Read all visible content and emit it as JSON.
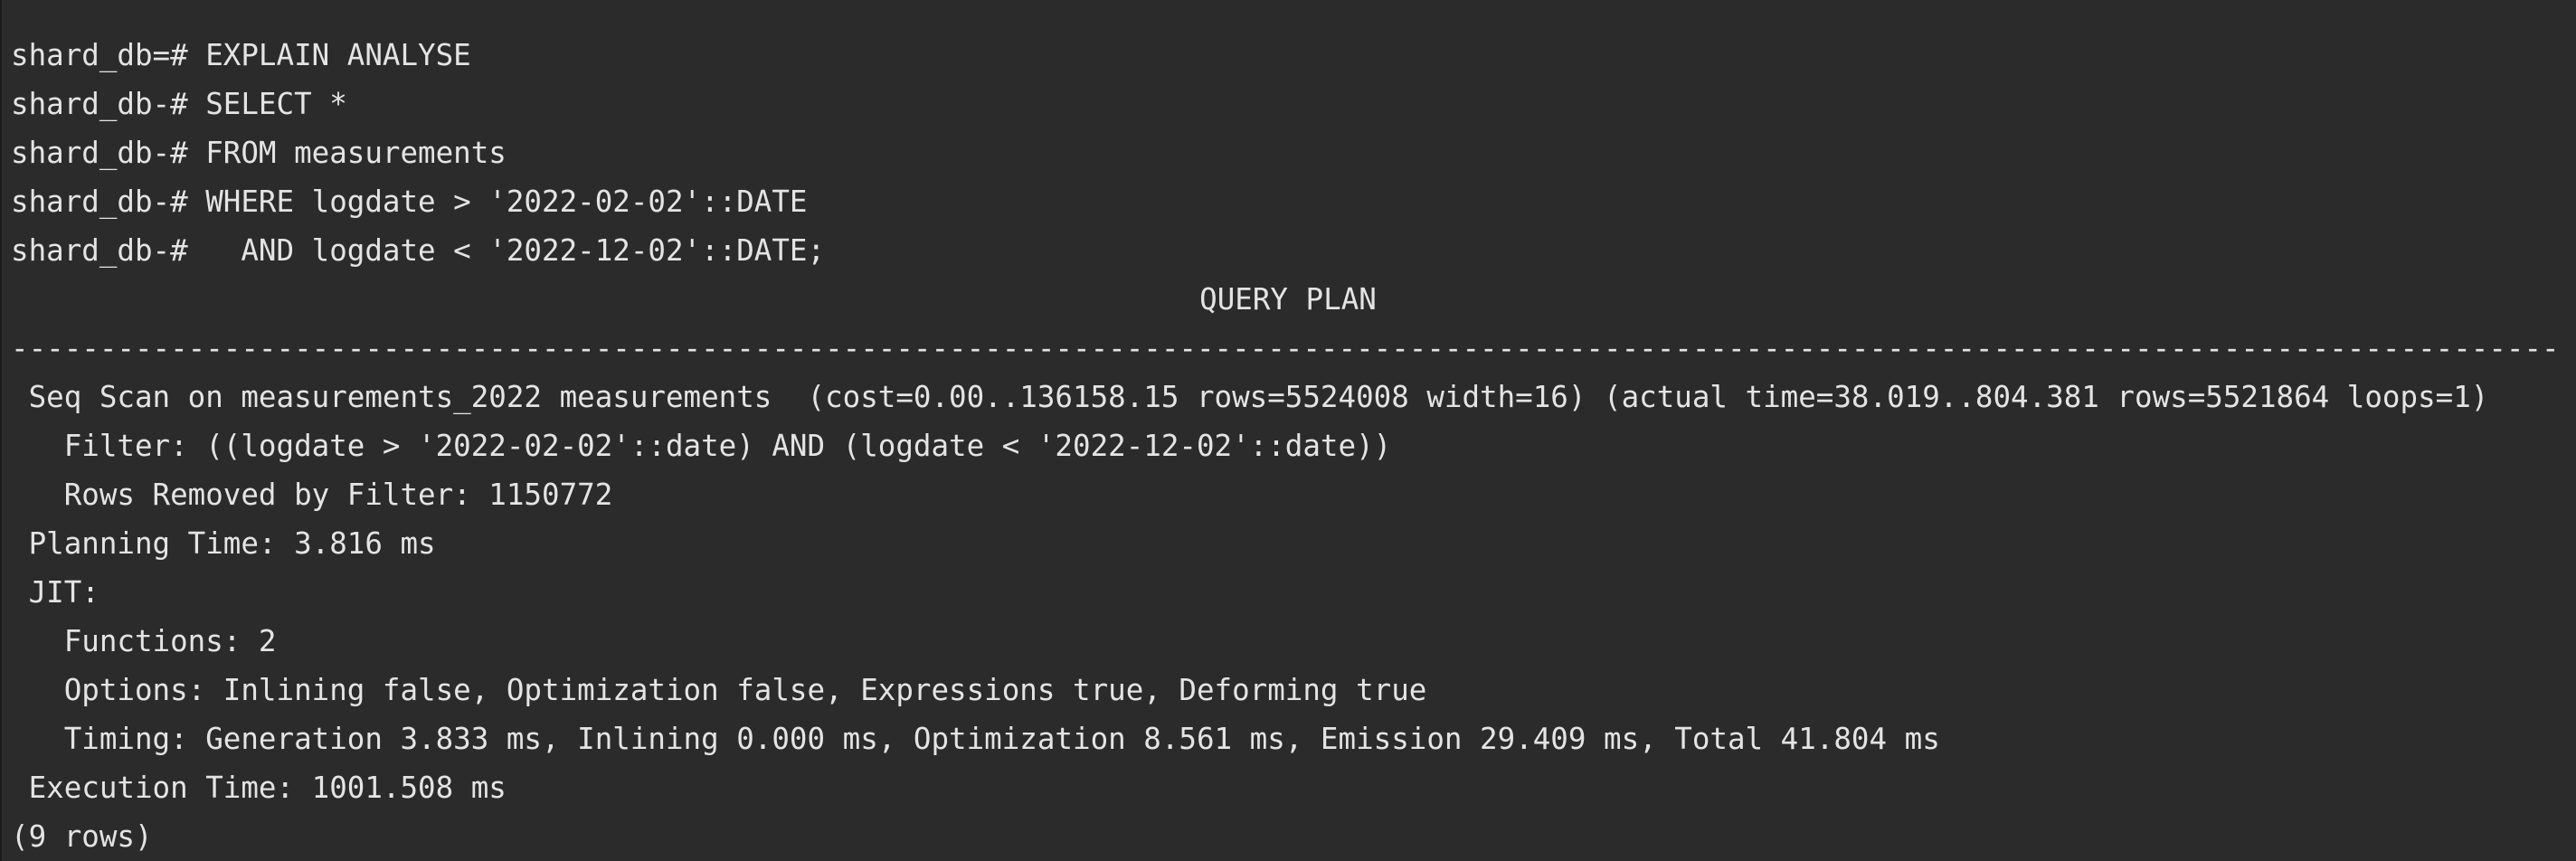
{
  "terminal": {
    "query_lines": [
      "shard_db=# EXPLAIN ANALYSE",
      "shard_db-# SELECT *",
      "shard_db-# FROM measurements",
      "shard_db-# WHERE logdate > '2022-02-02'::DATE",
      "shard_db-#   AND logdate < '2022-12-02'::DATE;"
    ],
    "plan_header": "QUERY PLAN",
    "plan_divider": "-----------------------------------------------------------------------------------------------------------------------------------------------------",
    "plan_rows": [
      " Seq Scan on measurements_2022 measurements  (cost=0.00..136158.15 rows=5524008 width=16) (actual time=38.019..804.381 rows=5521864 loops=1)",
      "   Filter: ((logdate > '2022-02-02'::date) AND (logdate < '2022-12-02'::date))",
      "   Rows Removed by Filter: 1150772",
      " Planning Time: 3.816 ms",
      " JIT:",
      "   Functions: 2",
      "   Options: Inlining false, Optimization false, Expressions true, Deforming true",
      "   Timing: Generation 3.833 ms, Inlining 0.000 ms, Optimization 8.561 ms, Emission 29.409 ms, Total 41.804 ms",
      " Execution Time: 1001.508 ms"
    ],
    "row_count": "(9 rows)"
  }
}
